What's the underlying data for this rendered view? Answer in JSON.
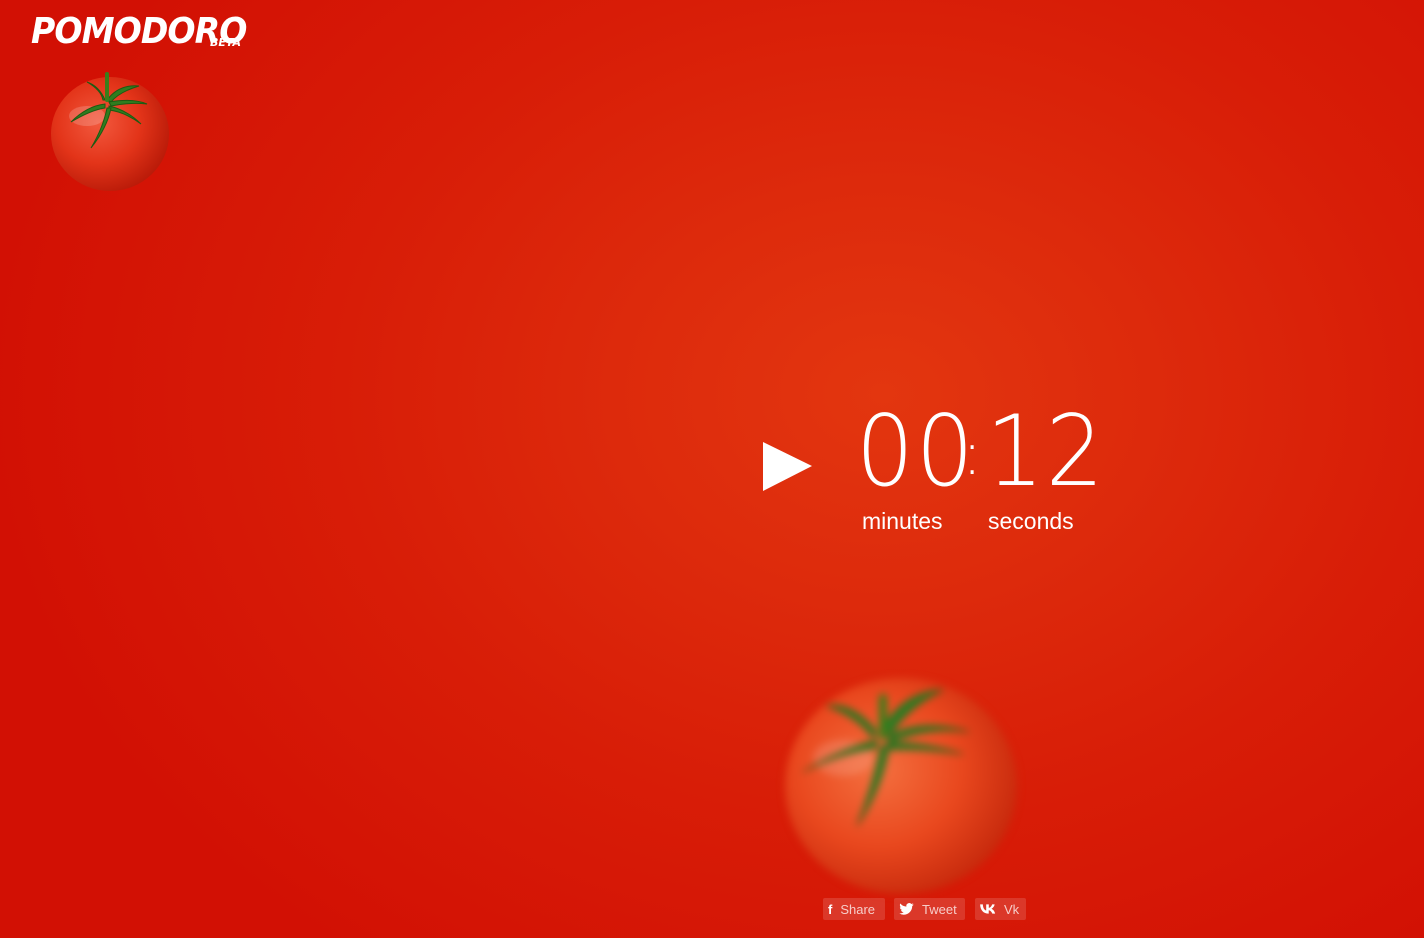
{
  "header": {
    "logo_text": "POMODORO",
    "beta_label": "BETA"
  },
  "timer": {
    "minutes": "00",
    "separator": ":",
    "seconds": "12",
    "minutes_label": "minutes",
    "seconds_label": "seconds",
    "state": "paused"
  },
  "controls": {
    "play_icon": "play-icon"
  },
  "social": {
    "share_label": "Share",
    "share_icon": "facebook-icon",
    "tweet_label": "Tweet",
    "tweet_icon": "twitter-icon",
    "vk_label": "Vk",
    "vk_icon": "vk-icon"
  },
  "colors": {
    "background": "#d81d07",
    "background_center": "#e3360f",
    "text": "#ffffff"
  }
}
